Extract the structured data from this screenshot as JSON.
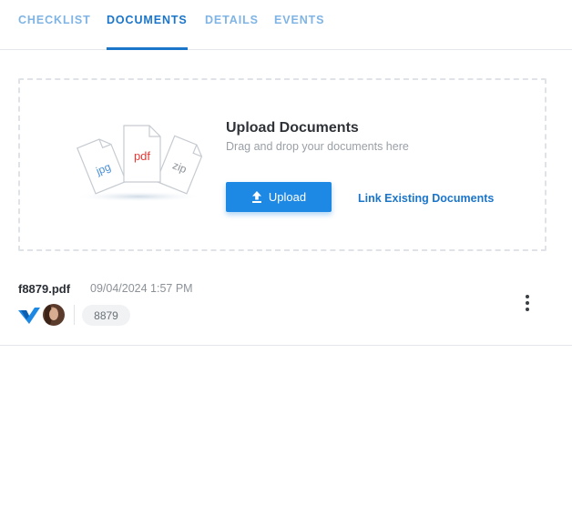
{
  "tabs": [
    {
      "label": "CHECKLIST",
      "active": false
    },
    {
      "label": "DOCUMENTS",
      "active": true
    },
    {
      "label": "DETAILS",
      "active": false
    },
    {
      "label": "EVENTS",
      "active": false
    }
  ],
  "upload": {
    "title": "Upload Documents",
    "subtitle": "Drag and drop your documents here",
    "button_label": "Upload",
    "button_icon": "upload-icon",
    "link_label": "Link Existing Documents",
    "illustration_labels": [
      "jpg",
      "pdf",
      "zip"
    ]
  },
  "documents": [
    {
      "name": "f8879.pdf",
      "date": "09/04/2024 1:57 PM",
      "tag": "8879",
      "icons": [
        "brand-logo-icon",
        "user-avatar"
      ],
      "menu_icon": "more-vertical-icon"
    }
  ],
  "colors": {
    "accent": "#1b75c9",
    "button": "#1e88e5",
    "tab_inactive": "#7fb4e4",
    "pdf_label": "#e53935",
    "file_label_blue": "#4a90d9",
    "zip_label": "#8c9298"
  }
}
